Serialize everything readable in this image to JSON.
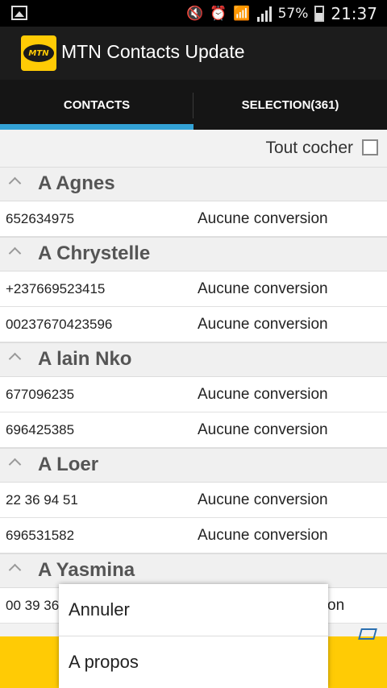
{
  "statusbar": {
    "battery": "57%",
    "time": "21:37",
    "battery_level": 0.57
  },
  "app": {
    "title": "MTN Contacts Update",
    "logo_text": "MTN",
    "brand_color": "#ffcb05",
    "accent_color": "#33a2d6"
  },
  "tabs": [
    {
      "label": "CONTACTS",
      "selected": true
    },
    {
      "label": "SELECTION(361)",
      "selected": false
    }
  ],
  "toolbar": {
    "check_all_label": "Tout cocher"
  },
  "groups": [
    {
      "name": "A Agnes",
      "rows": [
        {
          "number": "652634975",
          "status": "Aucune conversion"
        }
      ]
    },
    {
      "name": "A Chrystelle",
      "rows": [
        {
          "number": "+237669523415",
          "status": "Aucune conversion"
        },
        {
          "number": "00237670423596",
          "status": "Aucune conversion"
        }
      ]
    },
    {
      "name": "A lain Nko",
      "rows": [
        {
          "number": "677096235",
          "status": "Aucune conversion"
        },
        {
          "number": "696425385",
          "status": "Aucune conversion"
        }
      ]
    },
    {
      "name": "A Loer",
      "rows": [
        {
          "number": "22 36 94 51",
          "status": "Aucune conversion"
        },
        {
          "number": "696531582",
          "status": "Aucune conversion"
        }
      ]
    },
    {
      "name": "A Yasmina",
      "rows": [
        {
          "number": "00 39 36",
          "status": "on"
        }
      ]
    }
  ],
  "menu": {
    "items": [
      "Annuler",
      "A propos"
    ]
  }
}
